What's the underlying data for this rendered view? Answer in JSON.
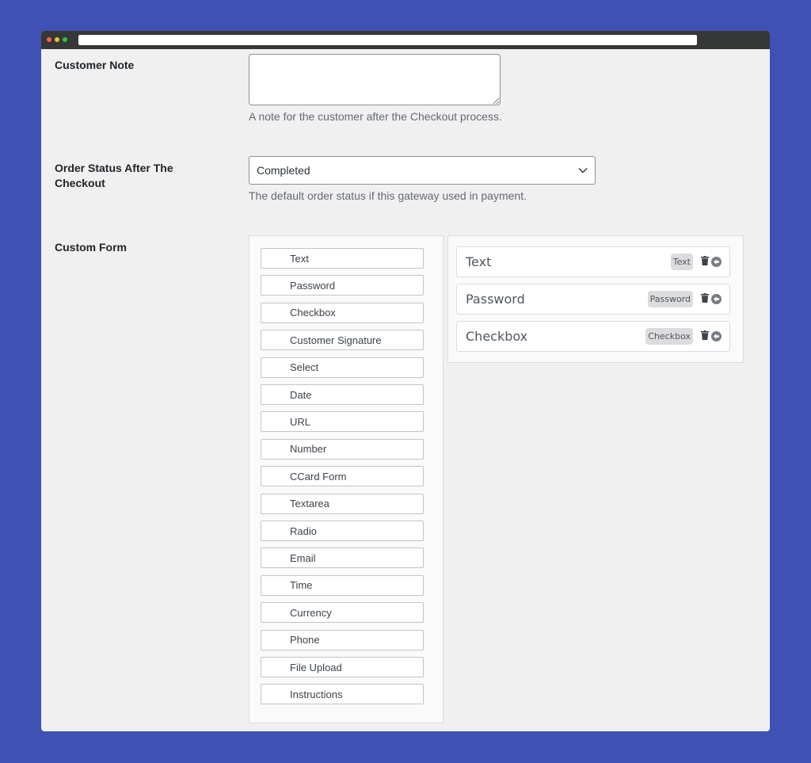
{
  "window": {
    "controls": [
      "close",
      "minimize",
      "maximize"
    ]
  },
  "customer_note": {
    "label": "Customer Note",
    "value": "",
    "description": "A note for the customer after the Checkout process."
  },
  "order_status": {
    "label": "Order Status After The Checkout",
    "selected": "Completed",
    "description": "The default order status if this gateway used in payment."
  },
  "custom_form": {
    "label": "Custom Form",
    "palette": [
      "Text",
      "Password",
      "Checkbox",
      "Customer Signature",
      "Select",
      "Date",
      "URL",
      "Number",
      "CCard Form",
      "Textarea",
      "Radio",
      "Email",
      "Time",
      "Currency",
      "Phone",
      "File Upload",
      "Instructions"
    ],
    "fields": [
      {
        "name": "Text",
        "type": "Text",
        "icons": [
          "trash-icon",
          "move-icon"
        ]
      },
      {
        "name": "Password",
        "type": "Password",
        "icons": [
          "trash-icon",
          "move-icon"
        ]
      },
      {
        "name": "Checkbox",
        "type": "Checkbox",
        "icons": [
          "trash-icon",
          "move-icon"
        ]
      }
    ]
  },
  "colors": {
    "background": "#3f51b5",
    "page": "#f0f0f1",
    "titlebar": "#363737",
    "badge": "#dcdcde"
  }
}
